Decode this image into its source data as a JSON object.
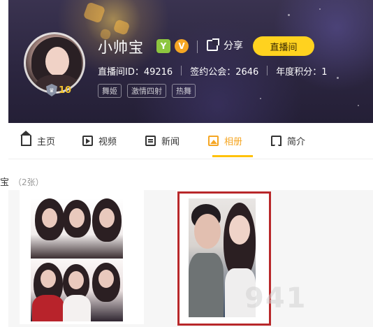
{
  "header": {
    "name": "小帅宝",
    "badge_y": "Y",
    "badge_v": "V",
    "share_label": "分享",
    "live_button": "直播间",
    "level": "10",
    "stats": {
      "room_id": "直播间ID：49216",
      "guild": "签约公会：2646",
      "annual_points": "年度积分：1"
    },
    "tags": [
      "舞姬",
      "激情四射",
      "热舞"
    ]
  },
  "tabs": [
    {
      "label": "主页",
      "icon": "home-icon"
    },
    {
      "label": "视频",
      "icon": "video-icon"
    },
    {
      "label": "新闻",
      "icon": "news-icon"
    },
    {
      "label": "相册",
      "icon": "album-icon",
      "active": true
    },
    {
      "label": "简介",
      "icon": "bookmark-icon"
    }
  ],
  "album": {
    "title_fragment": "宝",
    "count": "（2张）"
  },
  "watermark": "941"
}
